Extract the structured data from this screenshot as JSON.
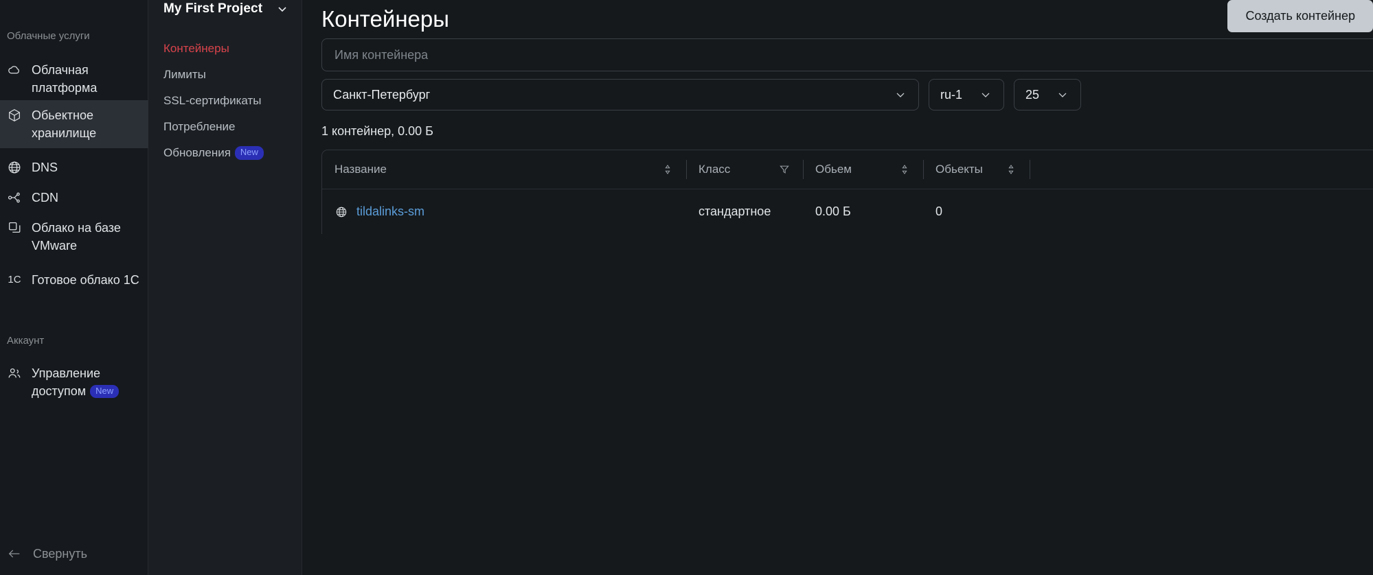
{
  "sidebar": {
    "sections": [
      {
        "label": "Облачные услуги"
      },
      {
        "label": "Аккаунт"
      }
    ],
    "items": [
      {
        "label": "Облачная платформа",
        "icon": "cloud-icon",
        "active": false
      },
      {
        "label": "Обьектное хранилище",
        "icon": "cube-icon",
        "active": true
      },
      {
        "label": "DNS",
        "icon": "globe-icon",
        "active": false
      },
      {
        "label": "CDN",
        "icon": "share-nodes-icon",
        "active": false
      },
      {
        "label": "Облако на базе VMware",
        "icon": "copy-icon",
        "active": false
      },
      {
        "label": "Готовое облако 1С",
        "icon": "one-c-icon",
        "active": false
      },
      {
        "label": "Управление доступом",
        "icon": "users-icon",
        "badge": "New",
        "active": false
      }
    ],
    "collapse_label": "Свернуть"
  },
  "project_nav": {
    "title": "My First Project",
    "items": [
      {
        "label": "Контейнеры",
        "active": true
      },
      {
        "label": "Лимиты",
        "active": false
      },
      {
        "label": "SSL-сертификаты",
        "active": false
      },
      {
        "label": "Потребление",
        "active": false
      },
      {
        "label": "Обновления",
        "badge": "New",
        "active": false
      }
    ]
  },
  "main": {
    "page_title": "Контейнеры",
    "create_button": "Создать контейнер",
    "search": {
      "placeholder": "Имя контейнера",
      "value": ""
    },
    "selects": {
      "region": "Санкт-Петербург",
      "pool": "ru-1",
      "page_size": "25"
    },
    "summary": "1 контейнер, 0.00 Б",
    "table": {
      "columns": [
        "Название",
        "Класс",
        "Обьем",
        "Обьекты"
      ],
      "rows": [
        {
          "name": "tildalinks-sm",
          "class": "стандартное",
          "volume": "0.00 Б",
          "objects": "0"
        }
      ]
    }
  },
  "colors": {
    "accent_red": "#d9434b",
    "link_blue": "#5b9dd9",
    "badge_bg": "#2b2fb5",
    "badge_fg": "#8ea2ff",
    "button_bg": "#c5cbd0"
  }
}
